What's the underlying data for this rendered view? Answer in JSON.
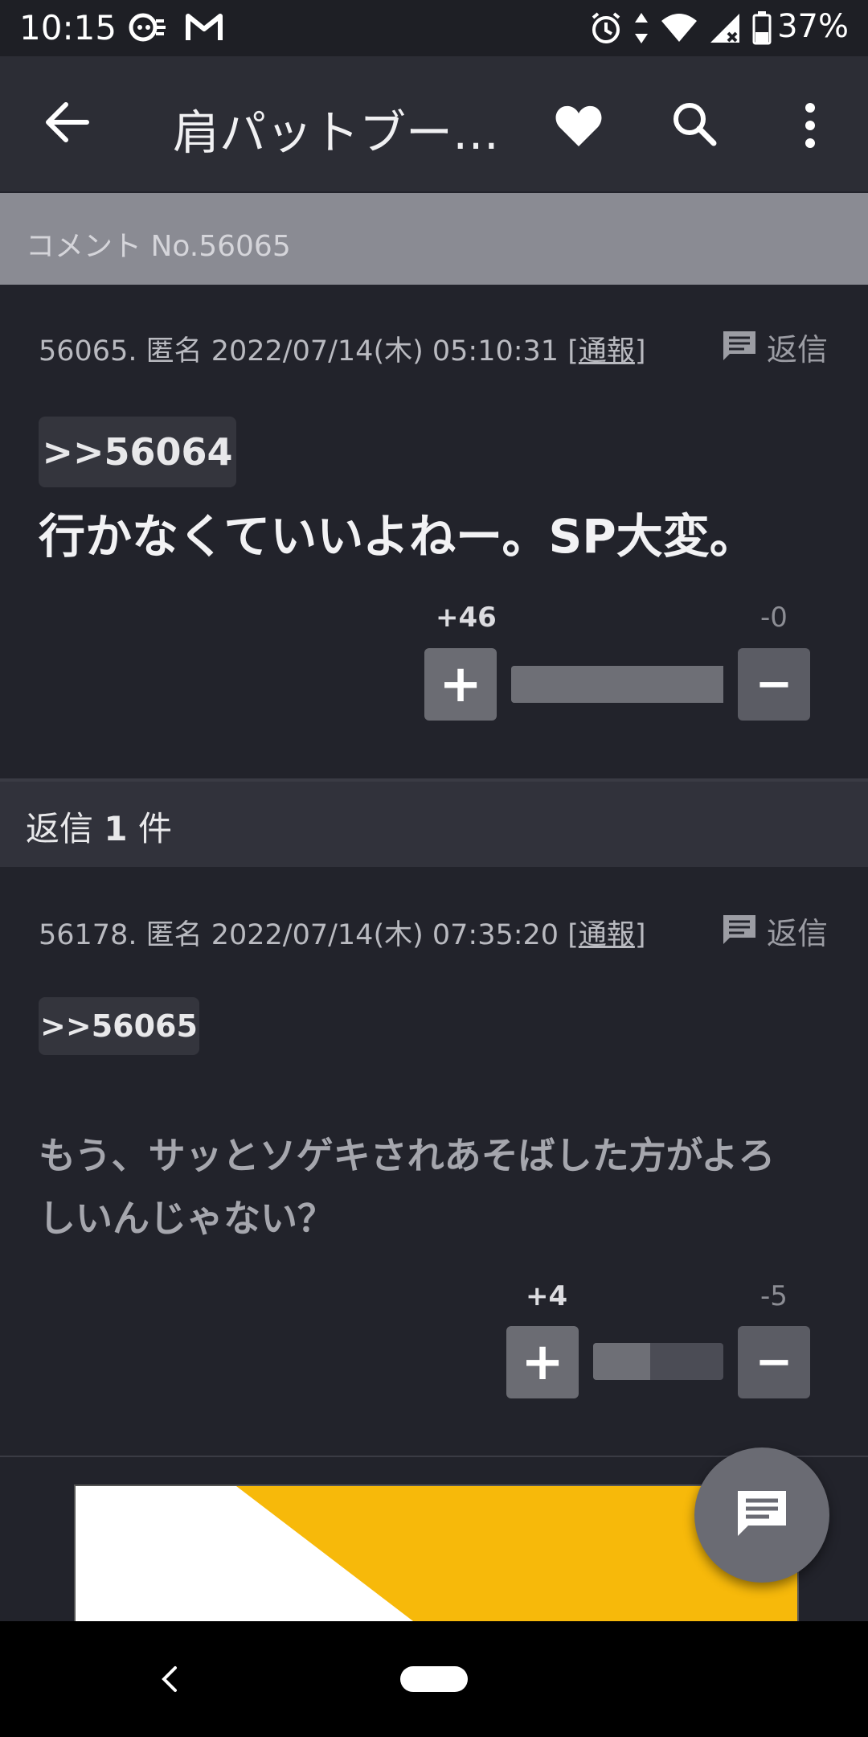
{
  "status_bar": {
    "time": "10:15",
    "battery": "37%",
    "left_icons": [
      "assistant-icon",
      "gmail-icon"
    ],
    "right_icons": [
      "alarm-icon",
      "data-arrows-icon",
      "wifi-icon",
      "signal-icon",
      "battery-icon"
    ]
  },
  "app_bar": {
    "title": "肩パットブー…",
    "back_icon": "back-arrow-icon",
    "favorite_icon": "heart-icon",
    "search_icon": "search-icon",
    "menu_icon": "more-vert-icon"
  },
  "comment_header": {
    "label": "コメント No.56065"
  },
  "main_comment": {
    "meta_prefix": "56065. 匿名 2022/07/14(木) 05:10:31 [",
    "report_label": "通報",
    "meta_suffix": "]",
    "reply_label": "返信",
    "quote": ">>56064",
    "body": "行かなくていいよねー。SP大変。",
    "plus_count": "+46",
    "minus_count": "-0",
    "plus_label": "+",
    "minus_label": "−",
    "plus_ratio": 1.0
  },
  "replies_header": {
    "prefix": "返信 ",
    "count": "1",
    "suffix": " 件"
  },
  "reply_comment": {
    "meta_prefix": "56178. 匿名 2022/07/14(木) 07:35:20 [",
    "report_label": "通報",
    "meta_suffix": "]",
    "reply_label": "返信",
    "quote": ">>56065",
    "body_line1": "もう、サッとソゲキされあそばした方がよろ",
    "body_line2": "しいんじゃない？",
    "plus_count": "+4",
    "minus_count": "-5",
    "plus_label": "+",
    "minus_label": "−",
    "plus_ratio": 0.44
  },
  "colors": {
    "background": "#22232b",
    "plus_color": "#dcdce0",
    "minus_color": "#8c8d94",
    "image_yellow": "#f7b90a"
  }
}
